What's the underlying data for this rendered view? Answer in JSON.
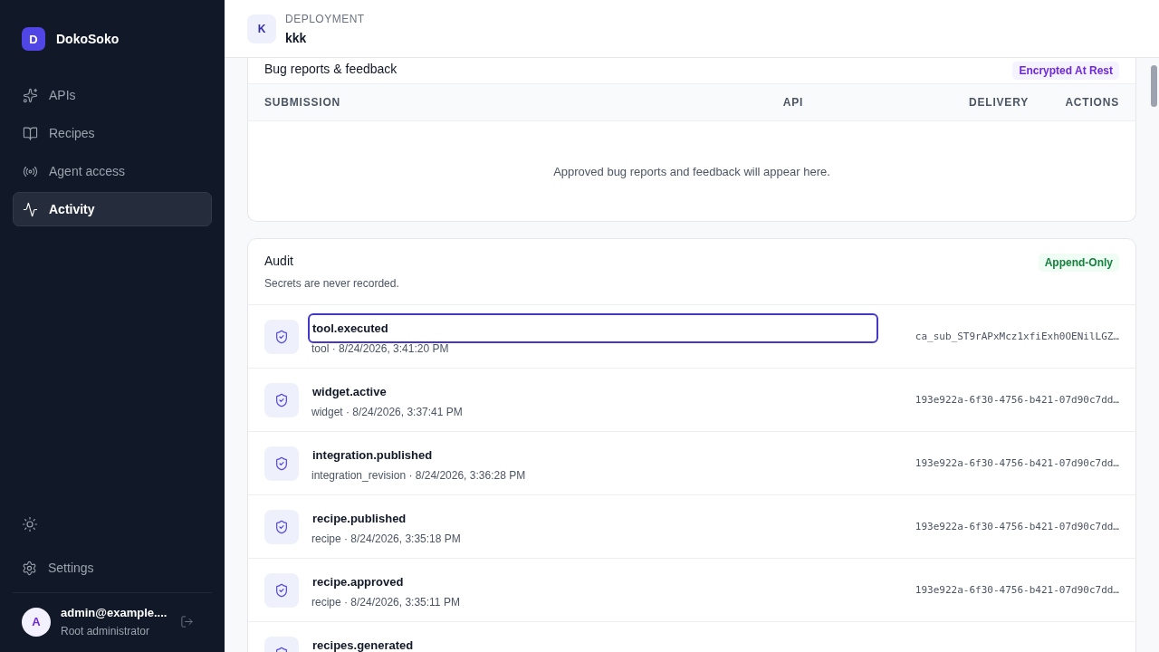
{
  "brand": {
    "initial": "D",
    "name": "DokoSoko"
  },
  "nav": [
    {
      "label": "APIs",
      "selected": false
    },
    {
      "label": "Recipes",
      "selected": false
    },
    {
      "label": "Agent access",
      "selected": false
    },
    {
      "label": "Activity",
      "selected": true
    }
  ],
  "settings": {
    "label": "Settings"
  },
  "user": {
    "initial": "A",
    "email": "admin@example....",
    "role": "Root administrator"
  },
  "header": {
    "initial": "K",
    "label": "DEPLOYMENT",
    "name": "kkk"
  },
  "feedback": {
    "title": "Bug reports & feedback",
    "badge": "Encrypted At Rest",
    "columns": [
      "SUBMISSION",
      "API",
      "DELIVERY",
      "ACTIONS"
    ],
    "empty": "Approved bug reports and feedback will appear here."
  },
  "audit": {
    "title": "Audit",
    "subtitle": "Secrets are never recorded.",
    "badge": "Append-Only",
    "rows": [
      {
        "event": "tool.executed",
        "meta": "tool · 8/24/2026, 3:41:20 PM",
        "id": "ca_sub_ST9rAPxMcz1xfiExh0OENilLGZ…",
        "focused": true
      },
      {
        "event": "widget.active",
        "meta": "widget · 8/24/2026, 3:37:41 PM",
        "id": "193e922a-6f30-4756-b421-07d90c7dd…",
        "focused": false
      },
      {
        "event": "integration.published",
        "meta": "integration_revision · 8/24/2026, 3:36:28 PM",
        "id": "193e922a-6f30-4756-b421-07d90c7dd…",
        "focused": false
      },
      {
        "event": "recipe.published",
        "meta": "recipe · 8/24/2026, 3:35:18 PM",
        "id": "193e922a-6f30-4756-b421-07d90c7dd…",
        "focused": false
      },
      {
        "event": "recipe.approved",
        "meta": "recipe · 8/24/2026, 3:35:11 PM",
        "id": "193e922a-6f30-4756-b421-07d90c7dd…",
        "focused": false
      },
      {
        "event": "recipes.generated",
        "focused": false
      }
    ]
  }
}
